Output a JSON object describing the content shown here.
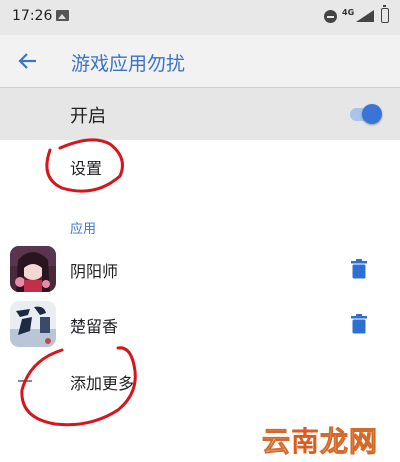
{
  "status_bar": {
    "time": "17:26",
    "network": "4G",
    "icons": [
      "image-notification-icon",
      "do-not-disturb-icon",
      "signal-icon",
      "battery-icon"
    ]
  },
  "header": {
    "title": "游戏应用勿扰",
    "back_icon": "arrow-left-icon"
  },
  "main_switch": {
    "label": "开启",
    "enabled": true
  },
  "settings": {
    "label": "设置"
  },
  "apps_section": {
    "header": "应用",
    "items": [
      {
        "name": "阴阳师",
        "icon": "onmyoji-app-icon",
        "action_icon": "trash-icon"
      },
      {
        "name": "楚留香",
        "icon": "chuliuxiang-app-icon",
        "action_icon": "trash-icon"
      }
    ]
  },
  "add_more": {
    "label": "添加更多",
    "icon": "add-icon"
  },
  "watermark": {
    "text_1": "云",
    "text_2": "南",
    "text_3": "龙网"
  },
  "colors": {
    "accent": "#3a74c8",
    "toggle_thumb": "#3a74d6",
    "toggle_track": "#a9c3ea",
    "annotation_red": "#d8141c",
    "trash": "#2f6fd0"
  }
}
